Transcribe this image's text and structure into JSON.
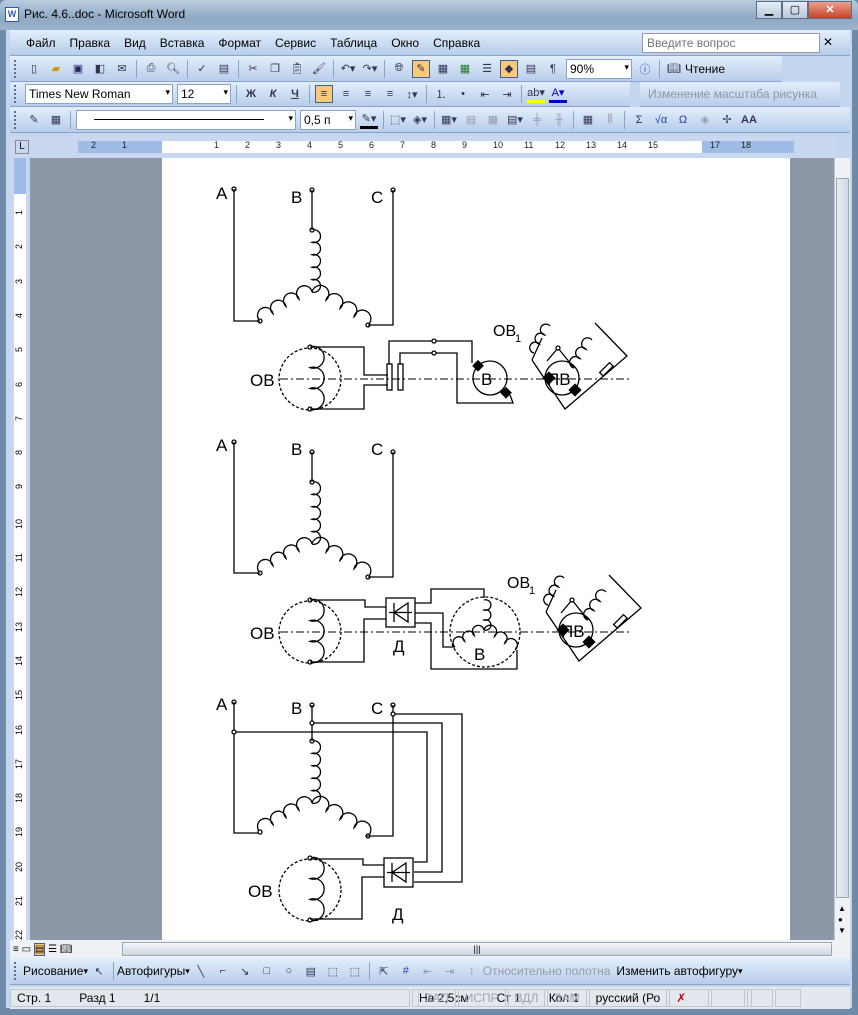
{
  "window": {
    "title": "Рис. 4.6..doc - Microsoft Word",
    "app_icon": "word-icon"
  },
  "menu": [
    "Файл",
    "Правка",
    "Вид",
    "Вставка",
    "Формат",
    "Сервис",
    "Таблица",
    "Окно",
    "Справка"
  ],
  "help": {
    "placeholder": "Введите вопрос"
  },
  "toolbar": {
    "zoom": "90%",
    "reading": "Чтение",
    "font": "Times New Roman",
    "size": "12",
    "bold": "Ж",
    "italic": "К",
    "underline": "Ч",
    "picture_scale": "Изменение масштаба рисунка",
    "line_weight": "0,5 п"
  },
  "ruler": {
    "h": [
      "2",
      "1",
      "1",
      "2",
      "3",
      "4",
      "5",
      "6",
      "7",
      "8",
      "9",
      "10",
      "11",
      "12",
      "13",
      "14",
      "15",
      "17",
      "18"
    ],
    "v": [
      "1",
      "2",
      "3",
      "4",
      "5",
      "6",
      "7",
      "8",
      "9",
      "10",
      "11",
      "12",
      "13",
      "14",
      "15",
      "16",
      "17",
      "18",
      "19",
      "20",
      "21",
      "22"
    ]
  },
  "drawing": {
    "draw": "Рисование",
    "autoshapes": "Автофигуры",
    "relative": "Относительно полотна",
    "change": "Изменить автофигуру"
  },
  "status": {
    "page": "Стр. 1",
    "section": "Разд 1",
    "pages": "1/1",
    "at": "На 2,5см",
    "line": "Ст 1",
    "col": "Кол 1",
    "rec": "ЗАП",
    "trk": "ИСПР",
    "ext": "ВДЛ",
    "ovr": "ЗАМ",
    "lang": "русский (Ро"
  },
  "diagram": {
    "phase_a": "A",
    "phase_b": "B",
    "phase_c": "C",
    "field": "ОВ",
    "exciter": "В",
    "sub_exciter": "ПВ",
    "sub_field": "ОВ",
    "sub_field_index": "1",
    "diode": "Д"
  }
}
